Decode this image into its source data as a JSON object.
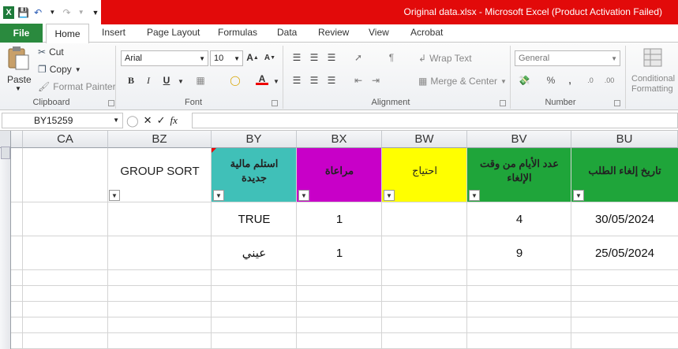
{
  "window": {
    "title": "Original data.xlsx  -  Microsoft Excel (Product Activation Failed)"
  },
  "tabs": [
    "File",
    "Home",
    "Insert",
    "Page Layout",
    "Formulas",
    "Data",
    "Review",
    "View",
    "Acrobat"
  ],
  "clipboard": {
    "paste": "Paste",
    "cut": "Cut",
    "copy": "Copy",
    "format_painter": "Format Painter",
    "label": "Clipboard"
  },
  "font": {
    "name": "Arial",
    "size": "10",
    "label": "Font"
  },
  "alignment": {
    "wrap_text": "Wrap Text",
    "merge_center": "Merge & Center",
    "label": "Alignment"
  },
  "number": {
    "format": "General",
    "label": "Number"
  },
  "styles": {
    "conditional": "Conditional",
    "formatting": "Formatting"
  },
  "formula_bar": {
    "name_box": "BY15259",
    "fx": "fx",
    "value": ""
  },
  "columns": [
    "CA",
    "BZ",
    "BY",
    "BX",
    "BW",
    "BV",
    "BU"
  ],
  "header_row": {
    "BZ": "GROUP SORT",
    "BY": "استلم مالية جديدة",
    "BX": "مراعاة",
    "BW": "احتياج",
    "BV": "عدد الأيام من وقت الإلغاء",
    "BU": "تاريخ إلغاء الطلب"
  },
  "header_colors": {
    "BY": "#40c0b8",
    "BX": "#c800c8",
    "BW": "#ffff00",
    "BV": "#1fa53a",
    "BU": "#1fa53a"
  },
  "rows": [
    {
      "BY": "TRUE",
      "BX": "1",
      "BW": "",
      "BV": "4",
      "BU": "30/05/2024"
    },
    {
      "BY": "عيني",
      "BX": "1",
      "BW": "",
      "BV": "9",
      "BU": "25/05/2024"
    }
  ]
}
